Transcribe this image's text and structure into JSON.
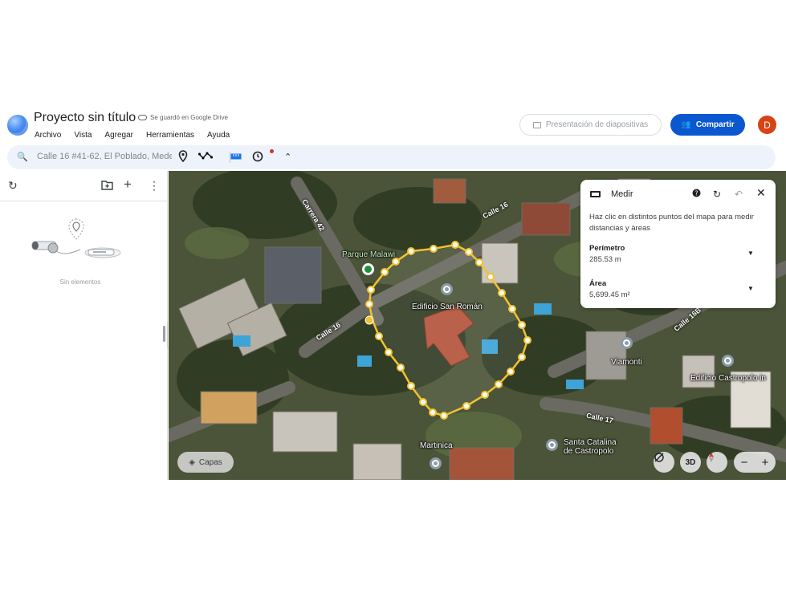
{
  "header": {
    "title": "Proyecto sin título",
    "saved_status": "Se guardó en Google Drive",
    "menu": [
      "Archivo",
      "Vista",
      "Agregar",
      "Herramientas",
      "Ayuda"
    ],
    "slides_button": "Presentación de diapositivas",
    "share_button": "Compartir",
    "avatar_initial": "D"
  },
  "search": {
    "value": "Calle 16 #41-62, El Poblado, Mede"
  },
  "left_panel": {
    "empty_text": "Sin elementos"
  },
  "map": {
    "place_labels": {
      "parque": "Parque Malawi",
      "san_roman": "Edificio San Román",
      "viamonti": "Viamonti",
      "castropolo": "Edificio Castropolo in",
      "martinica": "Martinica",
      "santa_catalina_1": "Santa Catalina",
      "santa_catalina_2": "de Castropolo"
    },
    "road_labels": {
      "carrera42": "Carrera 42",
      "calle16_top": "Calle 16",
      "calle16_left": "Calle 16",
      "calle16b": "Calle 16B",
      "calle17": "Calle 17"
    },
    "layers_button": "Capas",
    "view3d_button": "3D",
    "zoom_out": "−",
    "zoom_in": "+"
  },
  "measure_panel": {
    "title": "Medir",
    "description": "Haz clic en distintos puntos del mapa para medir distancias y áreas",
    "perimeter_label": "Perímetro",
    "perimeter_value": "285.53 m",
    "area_label": "Área",
    "area_value": "5,699.45 m²"
  },
  "colors": {
    "accent": "#0b57d0",
    "measure_line": "#f2c230",
    "avatar": "#d84315"
  }
}
